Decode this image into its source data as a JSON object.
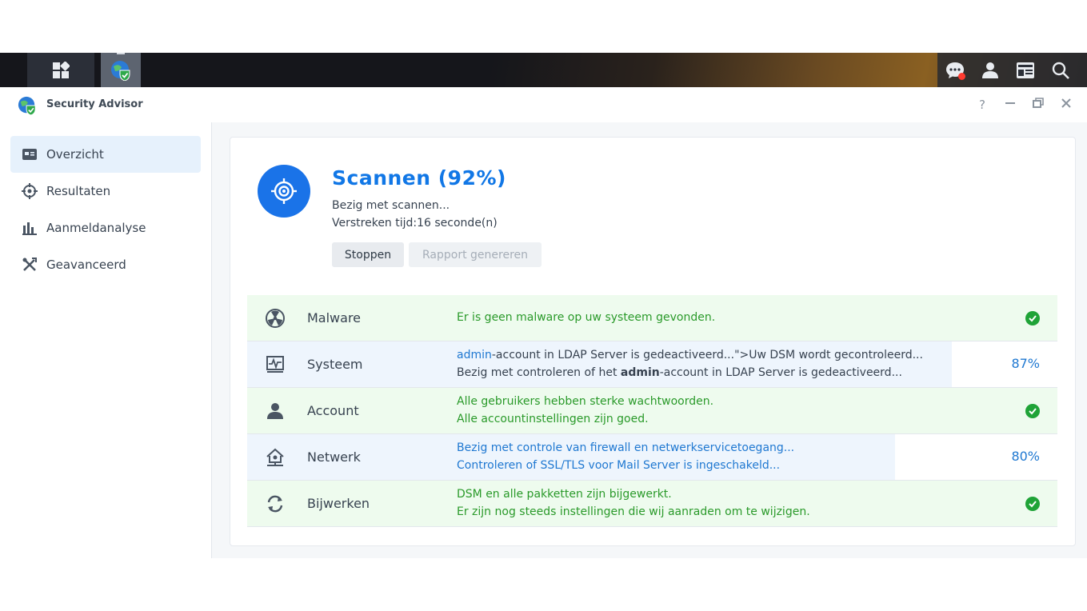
{
  "window": {
    "title": "Security Advisor",
    "controls": {
      "help": "?",
      "minimize": "–",
      "restore": "❐",
      "close": "✕"
    }
  },
  "sidebar": {
    "items": [
      {
        "label": "Overzicht",
        "icon": "overview-icon"
      },
      {
        "label": "Resultaten",
        "icon": "crosshair-icon"
      },
      {
        "label": "Aanmeldanalyse",
        "icon": "bar-chart-icon"
      },
      {
        "label": "Geavanceerd",
        "icon": "tools-icon"
      }
    ]
  },
  "scan": {
    "title": "Scannen (92%)",
    "status": "Bezig met scannen...",
    "elapsed": "Verstreken tijd:16 seconde(n)",
    "stop_label": "Stoppen",
    "report_label": "Rapport genereren"
  },
  "results": [
    {
      "name": "Malware",
      "icon": "radiation-icon",
      "state": "ok",
      "line1": "Er is geen malware op uw systeem gevonden.",
      "line2": ""
    },
    {
      "name": "Systeem",
      "icon": "monitor-pulse-icon",
      "state": "scanning",
      "progress": 0.87,
      "percent": "87%",
      "line1_link": "admin",
      "line1_rest": "-account in LDAP Server is gedeactiveerd...\">Uw DSM wordt gecontroleerd...",
      "line2_pre": "Bezig met controleren of het ",
      "line2_bold": "admin",
      "line2_post": "-account in LDAP Server is gedeactiveerd..."
    },
    {
      "name": "Account",
      "icon": "user-icon",
      "state": "ok",
      "line1": "Alle gebruikers hebben sterke wachtwoorden.",
      "line2": "Alle accountinstellingen zijn goed."
    },
    {
      "name": "Netwerk",
      "icon": "home-network-icon",
      "state": "scanning",
      "progress": 0.8,
      "percent": "80%",
      "line1": "Bezig met controle van firewall en netwerkservicetoegang...",
      "line2": "Controleren of SSL/TLS voor Mail Server is ingeschakeld..."
    },
    {
      "name": "Bijwerken",
      "icon": "refresh-icon",
      "state": "ok",
      "line1": "DSM en alle pakketten zijn bijgewerkt.",
      "line2": "Er zijn nog steeds instellingen die wij aanraden om te wijzigen."
    }
  ],
  "colors": {
    "accent": "#1177e6",
    "ok_text": "#2a9a2a",
    "ok_bg": "#eefbee",
    "check": "#1fa337"
  }
}
